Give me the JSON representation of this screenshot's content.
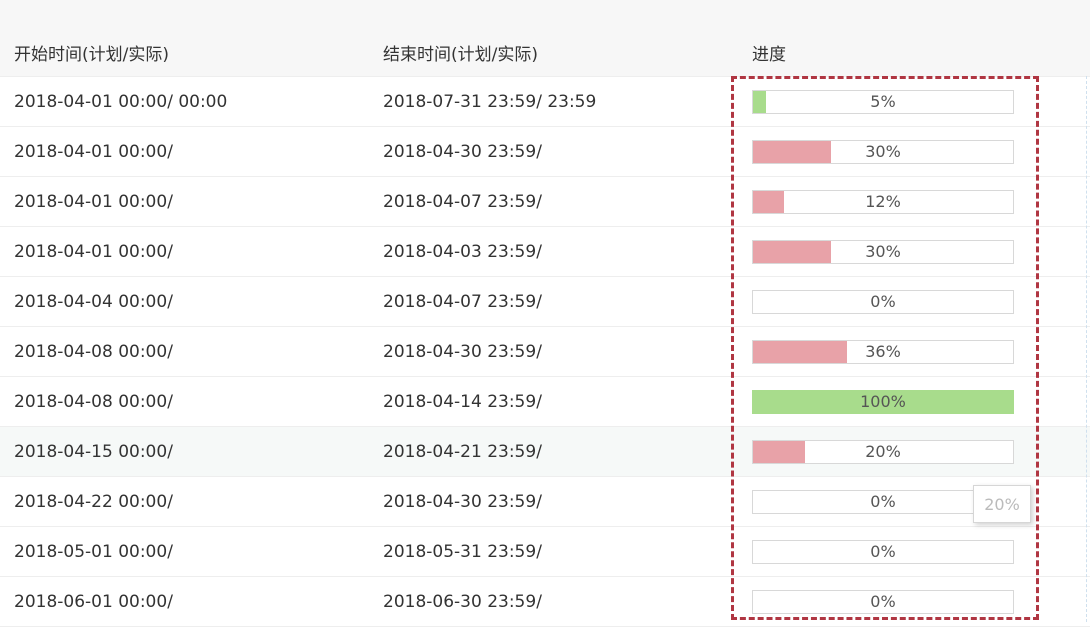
{
  "headers": {
    "start": "开始时间(计划/实际)",
    "end": "结束时间(计划/实际)",
    "progress": "进度"
  },
  "rows": [
    {
      "start": "2018-04-01 00:00/ 00:00",
      "end": "2018-07-31 23:59/ 23:59",
      "progress": "5%",
      "progress_value": 5,
      "bar_color": "green"
    },
    {
      "start": "2018-04-01 00:00/",
      "end": "2018-04-30 23:59/",
      "progress": "30%",
      "progress_value": 30,
      "bar_color": "red"
    },
    {
      "start": "2018-04-01 00:00/",
      "end": "2018-04-07 23:59/",
      "progress": "12%",
      "progress_value": 12,
      "bar_color": "red"
    },
    {
      "start": "2018-04-01 00:00/",
      "end": "2018-04-03 23:59/",
      "progress": "30%",
      "progress_value": 30,
      "bar_color": "red"
    },
    {
      "start": "2018-04-04 00:00/",
      "end": "2018-04-07 23:59/",
      "progress": "0%",
      "progress_value": 0,
      "bar_color": "red"
    },
    {
      "start": "2018-04-08 00:00/",
      "end": "2018-04-30 23:59/",
      "progress": "36%",
      "progress_value": 36,
      "bar_color": "red"
    },
    {
      "start": "2018-04-08 00:00/",
      "end": "2018-04-14 23:59/",
      "progress": "100%",
      "progress_value": 100,
      "bar_color": "green"
    },
    {
      "start": "2018-04-15 00:00/",
      "end": "2018-04-21 23:59/",
      "progress": "20%",
      "progress_value": 20,
      "bar_color": "red"
    },
    {
      "start": "2018-04-22 00:00/",
      "end": "2018-04-30 23:59/",
      "progress": "0%",
      "progress_value": 0,
      "bar_color": "red"
    },
    {
      "start": "2018-05-01 00:00/",
      "end": "2018-05-31 23:59/",
      "progress": "0%",
      "progress_value": 0,
      "bar_color": "red"
    },
    {
      "start": "2018-06-01 00:00/",
      "end": "2018-06-30 23:59/",
      "progress": "0%",
      "progress_value": 0,
      "bar_color": "red"
    }
  ],
  "tooltip": {
    "text": "20%"
  },
  "colors": {
    "bar_red": "#e8a2a8",
    "bar_green": "#a8dc8c",
    "highlight_border": "#b03642"
  }
}
